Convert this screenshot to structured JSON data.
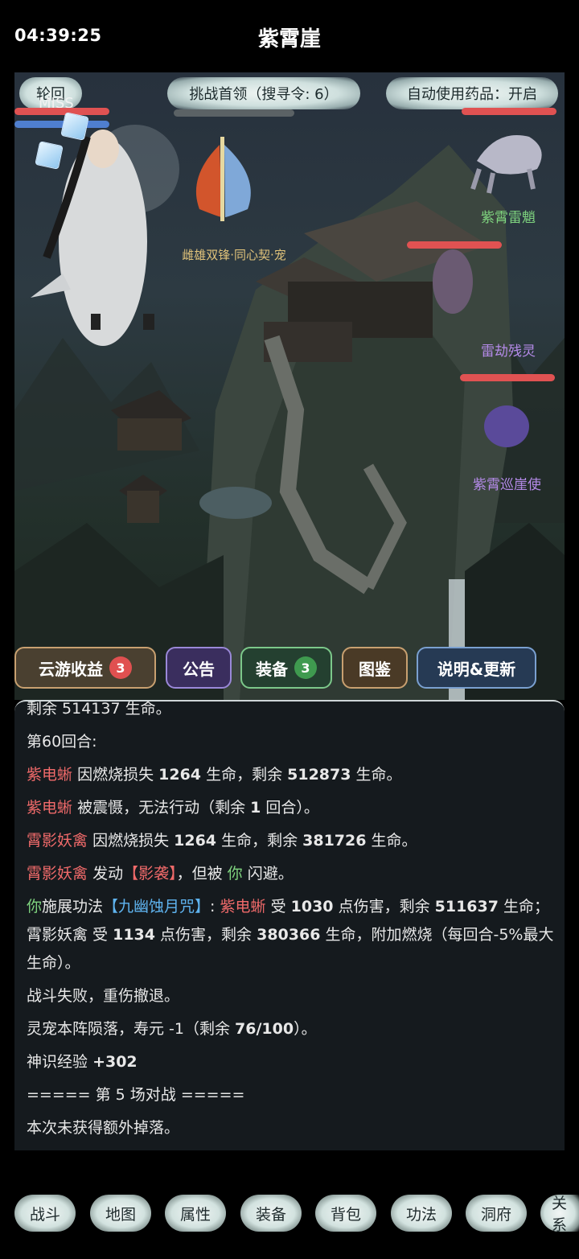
{
  "status": {
    "time": "04:39:25",
    "title": "紫霄崖"
  },
  "scene": {
    "back_label": "轮回",
    "miss_text": "MISS",
    "challenge_label": "挑战首领（搜寻令: 6）",
    "auto_label": "自动使用药品：开启",
    "pet_label": "雌雄双锋·同心契·宠",
    "enemies": [
      "紫霄雷魈",
      "雷劫残灵",
      "紫霄巡崖使"
    ],
    "enemy_colors": [
      "#7fd47f",
      "#b48ae8",
      "#b48ae8"
    ]
  },
  "actions": {
    "travel": "云游收益",
    "travel_badge": "3",
    "notice": "公告",
    "equip": "装备",
    "equip_badge": "3",
    "codex": "图鉴",
    "help": "说明&更新"
  },
  "log": {
    "partial": "剩余 514137 生命。",
    "round": "第60回合:",
    "l1_name": "紫电蜥",
    "l1_a": "因燃烧损失",
    "l1_n1": "1264",
    "l1_b": "生命，剩余",
    "l1_n2": "512873",
    "l1_c": "生命。",
    "l2_name": "紫电蜥",
    "l2_a": "被震慑，无法行动（剩余",
    "l2_n": "1",
    "l2_b": "回合）。",
    "l3_name": "霄影妖禽",
    "l3_a": "因燃烧损失",
    "l3_n1": "1264",
    "l3_b": "生命，剩余",
    "l3_n2": "381726",
    "l3_c": "生命。",
    "l4_name": "霄影妖禽",
    "l4_a": "发动",
    "l4_skill": "【影袭】",
    "l4_b": "，但被",
    "l4_you": "你",
    "l4_c": "闪避。",
    "l5_you": "你",
    "l5_a": "施展功法",
    "l5_skill": "【九幽蚀月咒】",
    "l5_b": ":",
    "l5_name": "紫电蜥",
    "l5_c": "受",
    "l5_n1": "1030",
    "l5_d": "点伤害，剩余",
    "l5_n2": "511637",
    "l5_e": "生命；霄影妖禽 受",
    "l5_n3": "1134",
    "l5_f": "点伤害，剩余",
    "l5_n4": "380366",
    "l5_g": "生命，附加燃烧（每回合-5%最大生命）。",
    "fail": "战斗失败，重伤撤退。",
    "pet_fall_a": "灵宠本阵陨落，寿元 -1（剩余",
    "pet_fall_n": "76/100",
    "pet_fall_b": "）。",
    "exp_a": "神识经验",
    "exp_n": "+302",
    "battle": "===== 第 5 场对战 =====",
    "drop": "本次未获得额外掉落。"
  },
  "nav": [
    "战斗",
    "地图",
    "属性",
    "装备",
    "背包",
    "功法",
    "洞府",
    "关系"
  ]
}
